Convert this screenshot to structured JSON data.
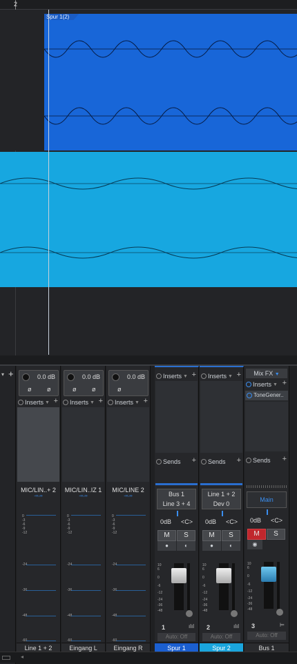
{
  "arrange": {
    "ruler_bar": "2",
    "clip_name": "Spur 1(2)"
  },
  "colors": {
    "track1": "#1866d8",
    "track2": "#17a7e0",
    "mute_active": "#c0272d",
    "accent": "#3a8ef0"
  },
  "input_channels": [
    {
      "gain": "0.0 dB",
      "phase_l": "ø",
      "phase_r": "ø",
      "inserts": "Inserts",
      "input": "MIC/LIN..+ 2",
      "name": "Line 1 + 2"
    },
    {
      "gain": "0.0 dB",
      "phase_l": "ø",
      "phase_r": "ø",
      "inserts": "Inserts",
      "input": "MIC/LIN..IZ 1",
      "name": "Eingang L"
    },
    {
      "gain": "0.0 dB",
      "phase_l": "ø",
      "phase_r": "",
      "inserts": "Inserts",
      "input": "MIC/LINE 2",
      "name": "Eingang R"
    }
  ],
  "meter_label": "-∞.∞",
  "meter_scale": [
    "0",
    "-3",
    "-6",
    "-9",
    "-12",
    "-24",
    "-36",
    "-48",
    "-60"
  ],
  "fader_scale": [
    "10",
    "6",
    "0",
    "-6",
    "-12",
    "-24",
    "-36",
    "-48"
  ],
  "mix_channels": [
    {
      "inserts": "Inserts",
      "sends": "Sends",
      "output1": "Bus 1",
      "output2": "Line 3 + 4",
      "level": "0dB",
      "pan": "<C>",
      "mute": "M",
      "solo": "S",
      "number": "1",
      "auto": "Auto: Off",
      "name": "Spur 1"
    },
    {
      "inserts": "Inserts",
      "sends": "Sends",
      "output1": "Line 1 + 2",
      "output2": "Dev 0",
      "level": "0dB",
      "pan": "<C>",
      "mute": "M",
      "solo": "S",
      "number": "2",
      "auto": "Auto: Off",
      "name": "Spur 2"
    },
    {
      "mixfx": "Mix FX",
      "inserts": "Inserts",
      "plugin": "ToneGener..",
      "sends": "Sends",
      "output1": "Main",
      "level": "0dB",
      "pan": "<C>",
      "mute": "M",
      "solo": "S",
      "number": "3",
      "auto": "Auto: Off",
      "name": "Bus 1"
    }
  ]
}
